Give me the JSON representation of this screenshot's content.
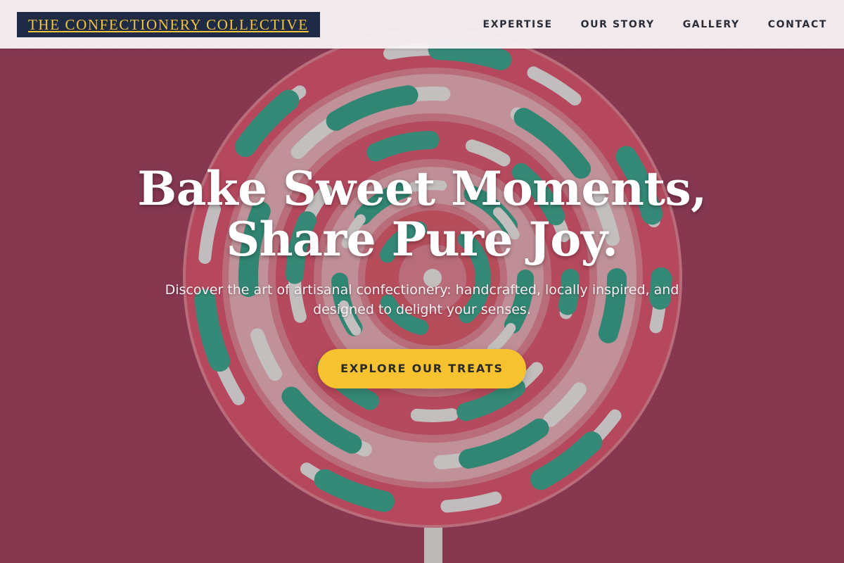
{
  "header": {
    "logo_text": "THE CONFECTIONERY COLLECTIVE",
    "nav": [
      {
        "label": "EXPERTISE"
      },
      {
        "label": "OUR STORY"
      },
      {
        "label": "GALLERY"
      },
      {
        "label": "CONTACT"
      }
    ]
  },
  "hero": {
    "background_image": "lollipop-photo",
    "headline_line1": "Bake Sweet Moments,",
    "headline_line2": "Share Pure Joy.",
    "subheadline": "Discover the art of artisanal confectionery: handcrafted, locally inspired, and designed to delight your senses.",
    "cta_label": "EXPLORE OUR TREATS"
  },
  "colors": {
    "header_bg": "#f6f0f2",
    "logo_bg": "#1f2a44",
    "logo_text": "#f2c43d",
    "nav_text": "#2a2d38",
    "hero_bg": "#a64460",
    "cta_bg": "#f6c22f",
    "cta_text": "#2a2a2a"
  }
}
